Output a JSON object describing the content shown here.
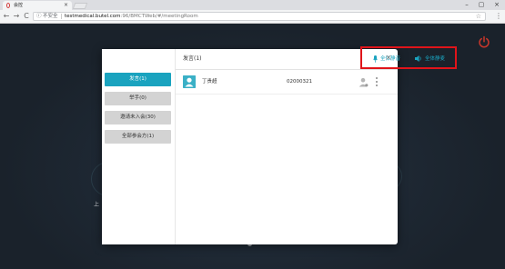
{
  "browser": {
    "tab_title": "会控",
    "tab_close": "×",
    "window_controls": [
      "–",
      "▢",
      "×"
    ],
    "nav": {
      "back": "←",
      "forward": "→",
      "reload": "C"
    },
    "address": {
      "security_label": "不安全",
      "host": "testmedical.butel.com",
      "path": ":96/BMCTWeb/#/meetingRoom"
    },
    "menu": "⋮"
  },
  "app": {
    "bg_text": "上"
  },
  "modal": {
    "sidebar": [
      {
        "label": "发言(1)",
        "active": true
      },
      {
        "label": "举手(0)",
        "active": false
      },
      {
        "label": "邀请未入会(30)",
        "active": false
      },
      {
        "label": "全部参会方(1)",
        "active": false
      }
    ],
    "header": {
      "title": "发言(1)",
      "mute_all_label": "全体静音",
      "speaker_off_label": "全体静麦",
      "close": "×"
    },
    "participants": [
      {
        "name": "丁贵超",
        "id": "02000321"
      }
    ]
  },
  "colors": {
    "accent": "#1aa3bf",
    "highlight": "#e0141a",
    "power": "#c8362a"
  }
}
